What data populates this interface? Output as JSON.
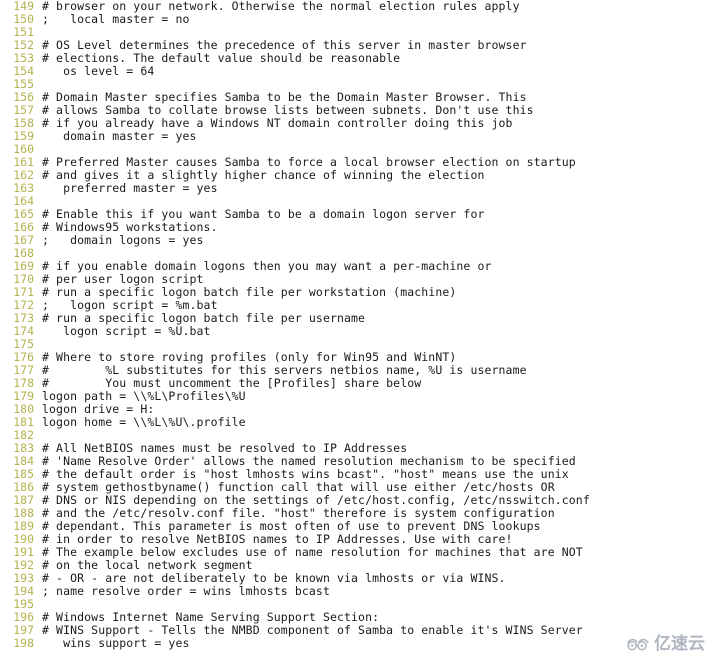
{
  "editor": {
    "file_type": "samba-config",
    "first_line_number": 149,
    "last_line_number": 198,
    "colors": {
      "background": "#ffffff",
      "text": "#1a1a1a",
      "line_number": "#b3b34d",
      "watermark": "#7f8a9a"
    },
    "lines": [
      {
        "n": "149",
        "t": "# browser on your network. Otherwise the normal election rules apply"
      },
      {
        "n": "150",
        "t": ";   local master = no"
      },
      {
        "n": "151",
        "t": ""
      },
      {
        "n": "152",
        "t": "# OS Level determines the precedence of this server in master browser"
      },
      {
        "n": "153",
        "t": "# elections. The default value should be reasonable"
      },
      {
        "n": "154",
        "t": "   os level = 64"
      },
      {
        "n": "155",
        "t": ""
      },
      {
        "n": "156",
        "t": "# Domain Master specifies Samba to be the Domain Master Browser. This"
      },
      {
        "n": "157",
        "t": "# allows Samba to collate browse lists between subnets. Don't use this"
      },
      {
        "n": "158",
        "t": "# if you already have a Windows NT domain controller doing this job"
      },
      {
        "n": "159",
        "t": "   domain master = yes"
      },
      {
        "n": "160",
        "t": ""
      },
      {
        "n": "161",
        "t": "# Preferred Master causes Samba to force a local browser election on startup"
      },
      {
        "n": "162",
        "t": "# and gives it a slightly higher chance of winning the election"
      },
      {
        "n": "163",
        "t": "   preferred master = yes"
      },
      {
        "n": "164",
        "t": ""
      },
      {
        "n": "165",
        "t": "# Enable this if you want Samba to be a domain logon server for"
      },
      {
        "n": "166",
        "t": "# Windows95 workstations."
      },
      {
        "n": "167",
        "t": ";   domain logons = yes"
      },
      {
        "n": "168",
        "t": ""
      },
      {
        "n": "169",
        "t": "# if you enable domain logons then you may want a per-machine or"
      },
      {
        "n": "170",
        "t": "# per user logon script"
      },
      {
        "n": "171",
        "t": "# run a specific logon batch file per workstation (machine)"
      },
      {
        "n": "172",
        "t": ";   logon script = %m.bat"
      },
      {
        "n": "173",
        "t": "# run a specific logon batch file per username"
      },
      {
        "n": "174",
        "t": "   logon script = %U.bat"
      },
      {
        "n": "175",
        "t": ""
      },
      {
        "n": "176",
        "t": "# Where to store roving profiles (only for Win95 and WinNT)"
      },
      {
        "n": "177",
        "t": "#        %L substitutes for this servers netbios name, %U is username"
      },
      {
        "n": "178",
        "t": "#        You must uncomment the [Profiles] share below"
      },
      {
        "n": "179",
        "t": "logon path = \\\\%L\\Profiles\\%U"
      },
      {
        "n": "180",
        "t": "logon drive = H:"
      },
      {
        "n": "181",
        "t": "logon home = \\\\%L\\%U\\.profile"
      },
      {
        "n": "182",
        "t": ""
      },
      {
        "n": "183",
        "t": "# All NetBIOS names must be resolved to IP Addresses"
      },
      {
        "n": "184",
        "t": "# 'Name Resolve Order' allows the named resolution mechanism to be specified"
      },
      {
        "n": "185",
        "t": "# the default order is \"host lmhosts wins bcast\". \"host\" means use the unix"
      },
      {
        "n": "186",
        "t": "# system gethostbyname() function call that will use either /etc/hosts OR"
      },
      {
        "n": "187",
        "t": "# DNS or NIS depending on the settings of /etc/host.config, /etc/nsswitch.conf"
      },
      {
        "n": "188",
        "t": "# and the /etc/resolv.conf file. \"host\" therefore is system configuration"
      },
      {
        "n": "189",
        "t": "# dependant. This parameter is most often of use to prevent DNS lookups"
      },
      {
        "n": "190",
        "t": "# in order to resolve NetBIOS names to IP Addresses. Use with care!"
      },
      {
        "n": "191",
        "t": "# The example below excludes use of name resolution for machines that are NOT"
      },
      {
        "n": "192",
        "t": "# on the local network segment"
      },
      {
        "n": "193",
        "t": "# - OR - are not deliberately to be known via lmhosts or via WINS."
      },
      {
        "n": "194",
        "t": "; name resolve order = wins lmhosts bcast"
      },
      {
        "n": "195",
        "t": ""
      },
      {
        "n": "196",
        "t": "# Windows Internet Name Serving Support Section:"
      },
      {
        "n": "197",
        "t": "# WINS Support - Tells the NMBD component of Samba to enable it's WINS Server"
      },
      {
        "n": "198",
        "t": "   wins support = yes"
      }
    ]
  },
  "watermark": {
    "text": "亿速云",
    "logo_name": "cloud-logo-icon"
  }
}
